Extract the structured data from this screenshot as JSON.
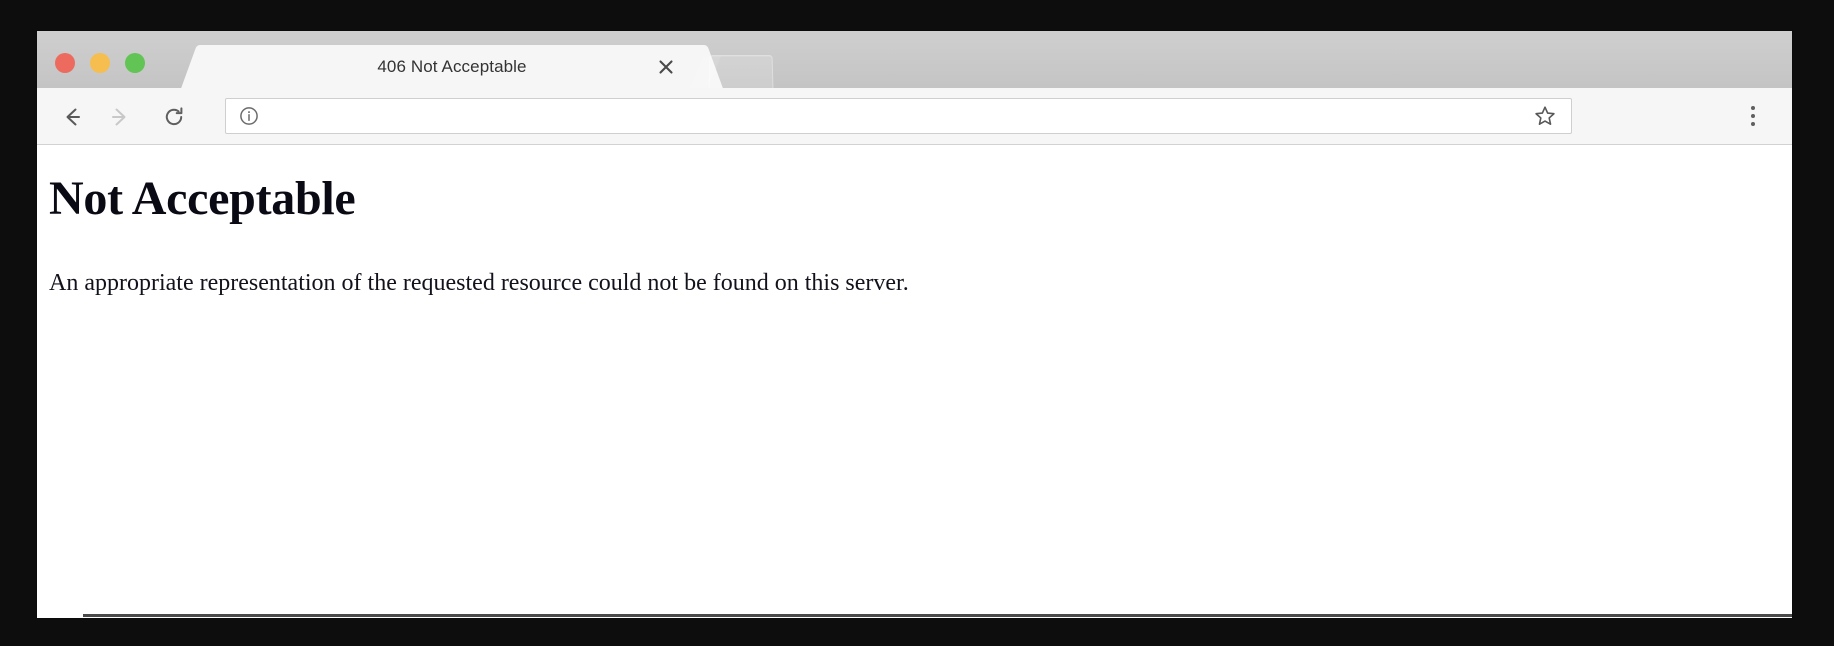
{
  "window": {
    "traffic_lights": [
      {
        "name": "close",
        "color": "#ed6a5e"
      },
      {
        "name": "minimize",
        "color": "#f5be4f"
      },
      {
        "name": "maximize",
        "color": "#61c454"
      }
    ]
  },
  "tabs": [
    {
      "title": "406 Not Acceptable",
      "active": true,
      "close_label": "×"
    }
  ],
  "new_tab": {
    "label": ""
  },
  "toolbar": {
    "back_icon": "back-arrow-icon",
    "forward_icon": "forward-arrow-icon",
    "reload_icon": "reload-icon",
    "site_info_icon": "info-circle-icon",
    "bookmark_icon": "star-outline-icon",
    "menu_icon": "three-dot-menu-icon",
    "back_enabled": true,
    "forward_enabled": false
  },
  "omnibox": {
    "value": "",
    "placeholder": ""
  },
  "page": {
    "heading": "Not Acceptable",
    "paragraph": "An appropriate representation of the requested resource could not be found on this server.",
    "has_rule": true
  },
  "colors": {
    "tabstrip_bg": "#c8c8c8",
    "toolbar_bg": "#f6f6f6",
    "active_tab_bg": "#f6f6f6",
    "page_bg": "#ffffff",
    "text": "#12121c",
    "rule": "#4a4a4a",
    "frame": "#0d0d0d"
  }
}
